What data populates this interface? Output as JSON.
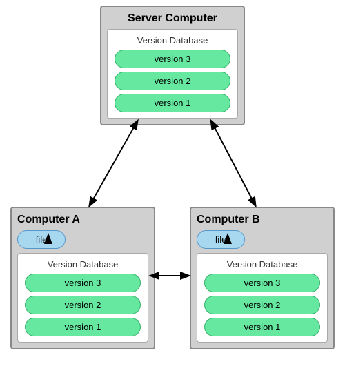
{
  "server": {
    "title": "Server Computer",
    "db_label": "Version Database",
    "versions": [
      "version 3",
      "version 2",
      "version 1"
    ]
  },
  "computer_a": {
    "title": "Computer A",
    "file_label": "file",
    "db_label": "Version Database",
    "versions": [
      "version 3",
      "version 2",
      "version 1"
    ]
  },
  "computer_b": {
    "title": "Computer B",
    "file_label": "file",
    "db_label": "Version Database",
    "versions": [
      "version 3",
      "version 2",
      "version 1"
    ]
  }
}
